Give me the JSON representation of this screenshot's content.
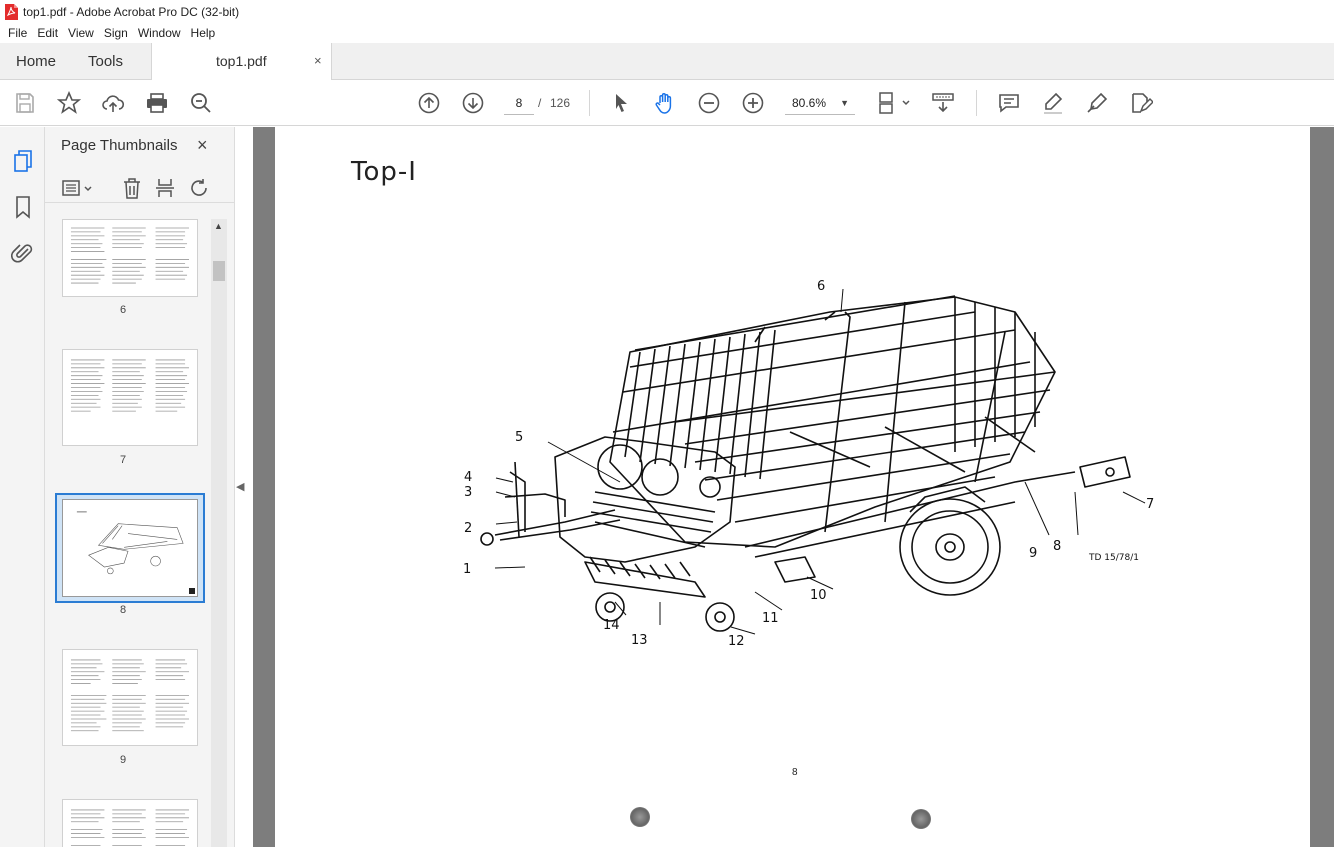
{
  "window": {
    "title": "top1.pdf - Adobe Acrobat Pro DC (32-bit)"
  },
  "menu": [
    "File",
    "Edit",
    "View",
    "Sign",
    "Window",
    "Help"
  ],
  "tabs": {
    "home": "Home",
    "tools": "Tools",
    "document": "top1.pdf",
    "close": "×"
  },
  "toolbar": {
    "current_page": "8",
    "separator": "/",
    "total_pages": "126",
    "zoom": "80.6%"
  },
  "sidebar": {
    "title": "Page Thumbnails",
    "close": "×"
  },
  "thumbnails": [
    {
      "label": "6"
    },
    {
      "label": "7"
    },
    {
      "label": "8",
      "selected": true
    },
    {
      "label": "9"
    }
  ],
  "page": {
    "heading": "Top-I",
    "page_number": "8",
    "figure_code": "TD 15/78/1",
    "callouts": [
      "1",
      "2",
      "3",
      "4",
      "5",
      "6",
      "7",
      "8",
      "9",
      "10",
      "11",
      "12",
      "13",
      "14"
    ]
  }
}
